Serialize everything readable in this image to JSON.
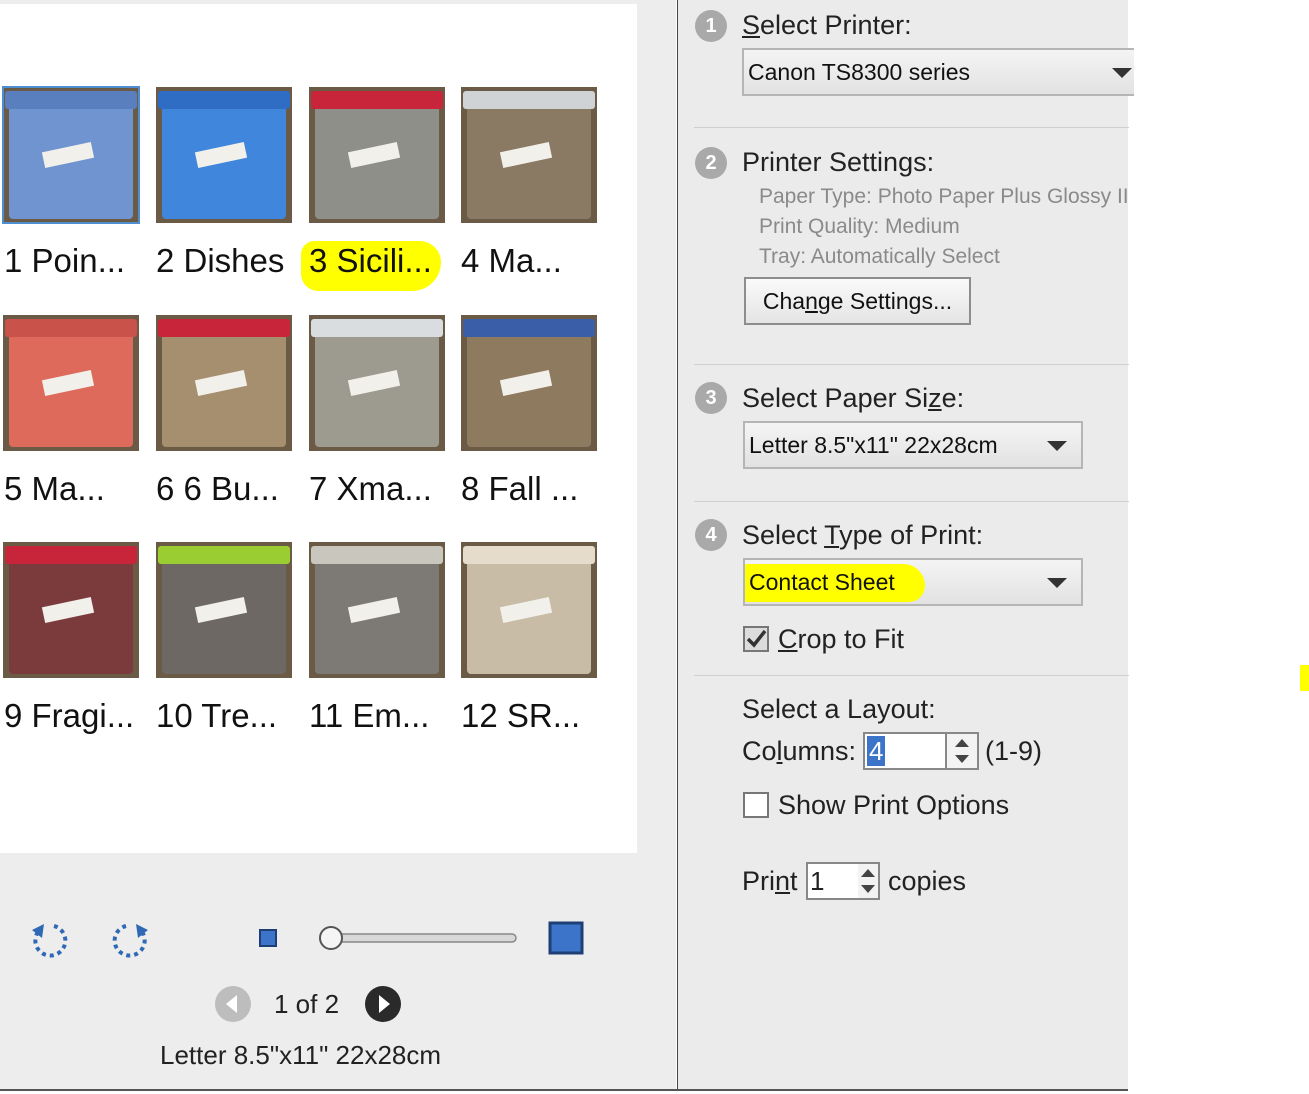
{
  "preview": {
    "thumbnails": [
      {
        "caption": "1 Poin...",
        "bg": "#6f94d0",
        "lid": "#5a7fbf",
        "label": "1",
        "selected": true
      },
      {
        "caption": "2 Dishes",
        "bg": "#3f86dc",
        "lid": "#2f6dc4",
        "label": "2",
        "selected": false
      },
      {
        "caption": "3 Sicili...",
        "bg": "#8d8f88",
        "lid": "#c8243a",
        "label": "3",
        "selected": false
      },
      {
        "caption": "4 Ma...",
        "bg": "#8a7a64",
        "lid": "#cfd3d6",
        "label": "4",
        "selected": false
      },
      {
        "caption": "5 Ma...",
        "bg": "#de6a5c",
        "lid": "#c9524a",
        "label": "5",
        "selected": false
      },
      {
        "caption": "6 6 Bu...",
        "bg": "#a58f6e",
        "lid": "#c8243a",
        "label": "6",
        "selected": false
      },
      {
        "caption": "7 Xma...",
        "bg": "#9d9a8f",
        "lid": "#dadde0",
        "label": "7",
        "selected": false
      },
      {
        "caption": "8 Fall ...",
        "bg": "#8d7a5f",
        "lid": "#3a5fa8",
        "label": "8",
        "selected": false
      },
      {
        "caption": "9 Fragi...",
        "bg": "#7b3b3d",
        "lid": "#c8243a",
        "label": "9",
        "selected": false
      },
      {
        "caption": "10 Tre...",
        "bg": "#6d6863",
        "lid": "#9acd32",
        "label": "10",
        "selected": false
      },
      {
        "caption": "11 Em...",
        "bg": "#7d7a76",
        "lid": "#c9c6bd",
        "label": "11",
        "selected": false
      },
      {
        "caption": "12 SR...",
        "bg": "#c8bca6",
        "lid": "#e6dccb",
        "label": "12",
        "selected": false
      }
    ],
    "highlighted_caption_index": 2
  },
  "controls": {
    "rotate_left_icon": "rotate-ccw",
    "rotate_right_icon": "rotate-cw",
    "zoom_slider_value": 0,
    "page_indicator": "1 of 2",
    "paper_size_label": "Letter 8.5\"x11\" 22x28cm"
  },
  "settings": {
    "step1": {
      "number": "1",
      "title_pre": "S",
      "title_ul": "",
      "title": "elect Printer:",
      "printer": "Canon TS8300 series"
    },
    "step2": {
      "number": "2",
      "title": "Printer Settings:",
      "paper_type": "Paper Type: Photo Paper Plus Glossy II",
      "print_quality": "Print Quality: Medium",
      "tray": "Tray: Automatically Select",
      "change_pre": "Cha",
      "change_ul": "n",
      "change_post": "ge Settings..."
    },
    "step3": {
      "number": "3",
      "title_pre": "Select Paper Si",
      "title_ul": "z",
      "title_post": "e:",
      "paper_size": "Letter 8.5\"x11\" 22x28cm"
    },
    "step4": {
      "number": "4",
      "title_pre": "Select ",
      "title_ul": "T",
      "title_post": "ype of Print:",
      "print_type": "Contact Sheet",
      "crop_ul": "C",
      "crop_post": "rop to Fit",
      "crop_checked": true
    },
    "layout": {
      "title": "Select a Layout:",
      "columns_pre": "Co",
      "columns_ul": "l",
      "columns_post": "umns:",
      "columns_value": "4",
      "columns_range": "(1-9)",
      "show_options_label": "Show Print Options",
      "show_options_checked": false,
      "print_pre": "Pri",
      "print_ul": "n",
      "print_post": "t",
      "copies_value": "1",
      "copies_label": "copies"
    }
  },
  "colors": {
    "highlight": "#ffff00",
    "selection_border": "#4d8fd1",
    "step_badge": "#a9a9a9",
    "nav_button": "#2a2a2a"
  }
}
